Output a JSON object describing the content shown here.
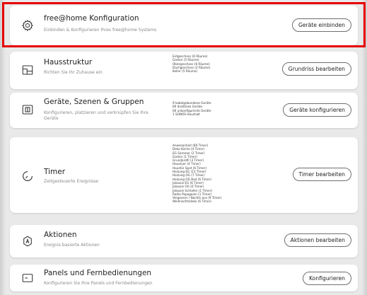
{
  "rows": [
    {
      "title": "free@home Konfiguration",
      "subtitle": "Einbinden & Konfigurieren Ihres free@home Systems",
      "button": "Geräte einbinden",
      "details": [],
      "icon": "gear-icon"
    },
    {
      "title": "Hausstruktur",
      "subtitle": "Richten Sie Ihr Zuhause ein",
      "button": "Grundriss bearbeiten",
      "details": [
        "Erdgeschoss (6 Räume)",
        "Garten (5 Räume)",
        "Obergeschoss (6 Räume)",
        "Dachgeschoss (2 Räume)",
        "Keller (5 Räume)"
      ],
      "icon": "floorplan-icon"
    },
    {
      "title": "Geräte, Szenen & Gruppen",
      "subtitle": "Konfigurieren, platzieren und verknüpfen Sie Ihre Geräte",
      "button": "Geräte konfigurieren",
      "details": [
        "9 kabelgebundene Geräte",
        "60 drahtlose Geräte",
        "60 unkonfigurierte Geräte",
        "1 SONOS Haushalt"
      ],
      "icon": "device-icon"
    },
    {
      "title": "Timer",
      "subtitle": "Zeitgesteuerte Ereignisse",
      "button": "Timer bearbeiten",
      "details": [
        "Anwesenheit (80 Timer)",
        "Deko Küche (4 Timer)",
        "EG Sommer (2 Timer)",
        "Garten (1 Timer)",
        "Grundprofil (3 Timer)",
        "Haustuer (4 Timer)",
        "Haustür Spot (6 Timer)",
        "Heizung EG (13 Timer)",
        "Heizung OG (7 Timer)",
        "Heizung OG Bad (6 Timer)",
        "Jalousie EG (6 Timer)",
        "Jalousie OG (6 Timer)",
        "Jalousie Schlafen (1 Timer)",
        "Radio Papagaien (1 Timer)",
        "Vergessen / Nachts aus (9 Timer)",
        "Weihnachtsdeko (6 Timer)"
      ],
      "icon": "timer-icon"
    },
    {
      "title": "Aktionen",
      "subtitle": "Ereignis basierte Aktionen",
      "button": "Aktionen bearbeiten",
      "details": [],
      "icon": "action-icon"
    },
    {
      "title": "Panels und Fernbedienungen",
      "subtitle": "Konfigurieren Sie Ihre Panels und Fernbedienungen",
      "button": "Konfigurieren",
      "details": [],
      "icon": "panel-icon"
    }
  ],
  "colors": {
    "highlight": "#e60000",
    "background": "#e9e9e9",
    "card": "#ffffff"
  }
}
